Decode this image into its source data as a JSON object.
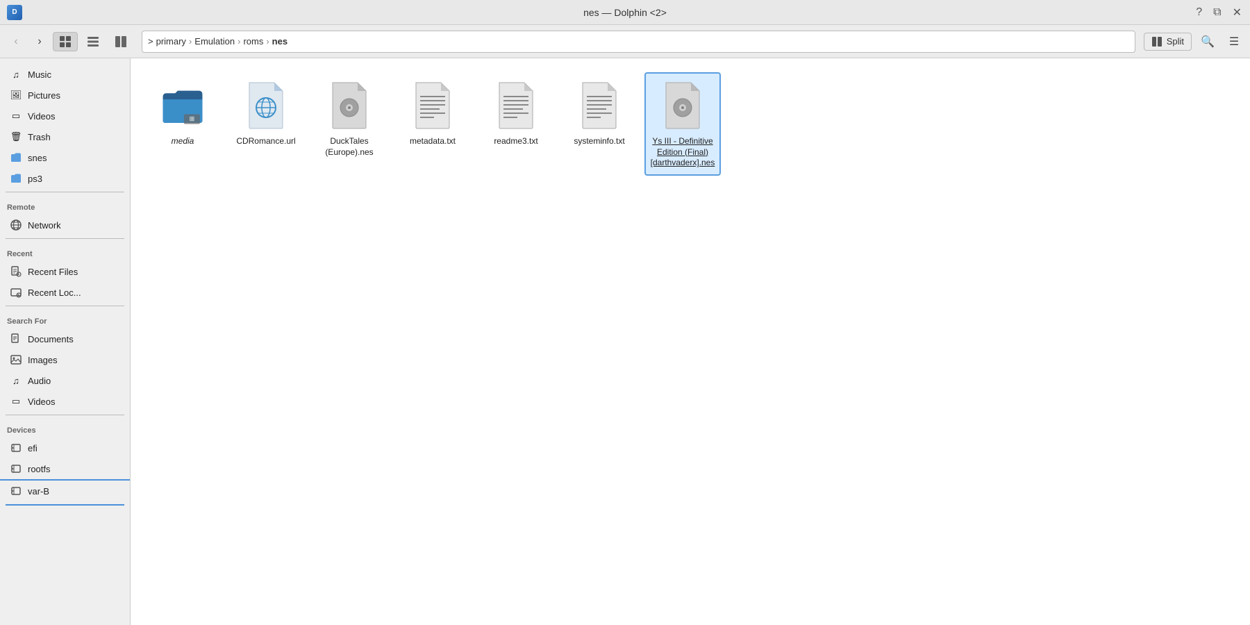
{
  "titlebar": {
    "title": "nes — Dolphin <2>",
    "logo_text": "D"
  },
  "toolbar": {
    "back_label": "‹",
    "forward_label": "›",
    "view_icons_label": "",
    "view_list_label": "",
    "view_split_label": "",
    "breadcrumb": {
      "prefix": ">",
      "segments": [
        "primary",
        "Emulation",
        "roms"
      ],
      "current": "nes"
    },
    "split_label": "Split",
    "search_label": "🔍",
    "menu_label": "☰"
  },
  "sidebar": {
    "places_items": [
      {
        "id": "music",
        "label": "Music",
        "icon": "music"
      },
      {
        "id": "pictures",
        "label": "Pictures",
        "icon": "pictures"
      },
      {
        "id": "videos",
        "label": "Videos",
        "icon": "videos"
      },
      {
        "id": "trash",
        "label": "Trash",
        "icon": "trash"
      },
      {
        "id": "snes",
        "label": "snes",
        "icon": "folder"
      },
      {
        "id": "ps3",
        "label": "ps3",
        "icon": "folder"
      }
    ],
    "remote_header": "Remote",
    "remote_items": [
      {
        "id": "network",
        "label": "Network",
        "icon": "network"
      }
    ],
    "recent_header": "Recent",
    "recent_items": [
      {
        "id": "recent-files",
        "label": "Recent Files",
        "icon": "recent-files"
      },
      {
        "id": "recent-locs",
        "label": "Recent Loc...",
        "icon": "recent-locs"
      }
    ],
    "search_header": "Search For",
    "search_items": [
      {
        "id": "documents",
        "label": "Documents",
        "icon": "documents"
      },
      {
        "id": "images",
        "label": "Images",
        "icon": "images"
      },
      {
        "id": "audio",
        "label": "Audio",
        "icon": "audio"
      },
      {
        "id": "videos-search",
        "label": "Videos",
        "icon": "videos"
      }
    ],
    "devices_header": "Devices",
    "devices_items": [
      {
        "id": "efi",
        "label": "efi",
        "icon": "drive"
      },
      {
        "id": "rootfs",
        "label": "rootfs",
        "icon": "drive"
      },
      {
        "id": "var-b",
        "label": "var-B",
        "icon": "drive"
      }
    ]
  },
  "files": [
    {
      "id": "media",
      "name": "media",
      "type": "folder-special",
      "italic": true
    },
    {
      "id": "cdromance",
      "name": "CDRomance.url",
      "type": "url"
    },
    {
      "id": "ducktales",
      "name": "DuckTales (Europe).nes",
      "type": "nes"
    },
    {
      "id": "metadata",
      "name": "metadata.txt",
      "type": "txt"
    },
    {
      "id": "readme3",
      "name": "readme3.txt",
      "type": "txt"
    },
    {
      "id": "systeminfo",
      "name": "systeminfo.txt",
      "type": "txt"
    },
    {
      "id": "ys3",
      "name": "Ys III - Definitive Edition (Final) [darthvaderx].nes",
      "type": "nes",
      "selected": true
    }
  ],
  "colors": {
    "folder_blue": "#3a8fc9",
    "folder_dark": "#1a5a8a",
    "accent_blue": "#5a9ee0",
    "url_icon": "#3a8fc9"
  }
}
